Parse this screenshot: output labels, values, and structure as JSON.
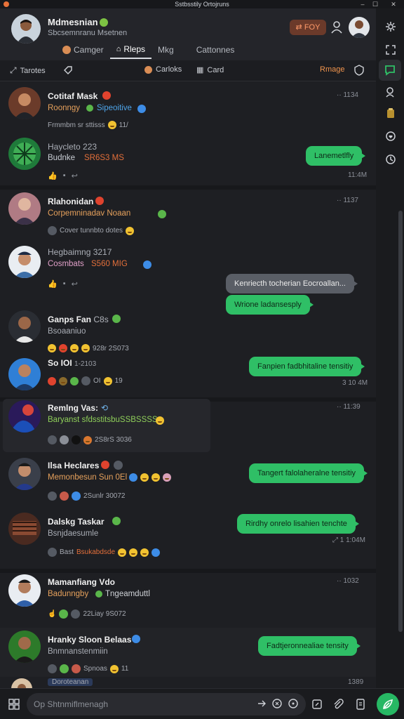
{
  "window": {
    "title": "Sstbsstily Ortojruns"
  },
  "header": {
    "name": "Mdmesnian",
    "subtitle": "Sbcsemnranu Msetnen",
    "badge_label": "FOY",
    "tabs": [
      {
        "label": "Camger"
      },
      {
        "label": "Rleps"
      },
      {
        "label": "Mkg"
      },
      {
        "label": "Cattonnes"
      }
    ]
  },
  "filters": {
    "left_label": "Tarotes",
    "mid1_label": "Carloks",
    "mid2_label": "Card",
    "right_label": "Rmage"
  },
  "chats": [
    {
      "name": "Cotitaf Mask",
      "sub_a": "Roonngy",
      "sub_b": "Sipeoitive",
      "meta": "Frmmbm sr sttisss",
      "meta2": "11/",
      "time": "1134"
    },
    {
      "name": "Haycleto 223",
      "sub_a": "Budnke",
      "sub_b": "SR6S3 MS",
      "bubble": "Lanemetlfly",
      "time": "11:4M"
    },
    {
      "name": "Rlahonidan",
      "sub_a": "Corpemninadav Noaan",
      "meta": "Cover tunnbto dotes",
      "time": "1137"
    },
    {
      "name": "Hegbaimng 3217",
      "sub_a": "Cosmbats",
      "sub_b": "S560 MIG",
      "bubble_gray": "Kenriecth tocherian Eocroallan...",
      "bubble": "Wrione ladansesply"
    },
    {
      "name": "Ganps Fan",
      "badge": "C8s",
      "sub_a": "Bsoaaniuo",
      "meta": "928r 2S073"
    },
    {
      "name": "So IOI",
      "time_inline": "1-2103",
      "bubble": "Fanpien fadbhitaline tensitiy",
      "meta": "OI",
      "meta2": "19",
      "time": "3 10 4M"
    },
    {
      "name": "Remlng Vas:",
      "sub_a": "Baryanst sfdsstitsbuSSBSSSS",
      "meta": "2S8rS 3036",
      "time": "11:39"
    },
    {
      "name": "Ilsa Heclares",
      "sub_a": "Memonbesun Sun 0El",
      "bubble": "Tangert falolaheralne tensitiy",
      "meta": "2Sunlr 30072"
    },
    {
      "name": "Dalskg Taskar",
      "sub_a": "Bsnjdaesumle",
      "bubble": "Rirdhy onrelo lisahien tenchte",
      "meta": "Bast",
      "meta2": "Bsukabdsde",
      "time": "1 1:04M"
    },
    {
      "name": "Mamanfiang Vdo",
      "sub_a": "Badunngby",
      "sub_b": "Tngeamduttl",
      "meta": "22Liay 9S072",
      "time": "1032"
    },
    {
      "name": "Hranky Sloon Belaas",
      "sub_a": "Bnmnanstenmiin",
      "bubble": "Fadtjeronnealiae tensity",
      "meta": "Spnoas",
      "meta2": "11"
    },
    {
      "name": "",
      "sub_a": "Doroteanan",
      "time": "1389"
    }
  ],
  "bottom": {
    "search_placeholder": "Op Shtnmiflmenagh"
  },
  "colors": {
    "accent_green": "#2fbf66",
    "badge_orange": "#f0944d",
    "bg": "#1e1f23"
  }
}
